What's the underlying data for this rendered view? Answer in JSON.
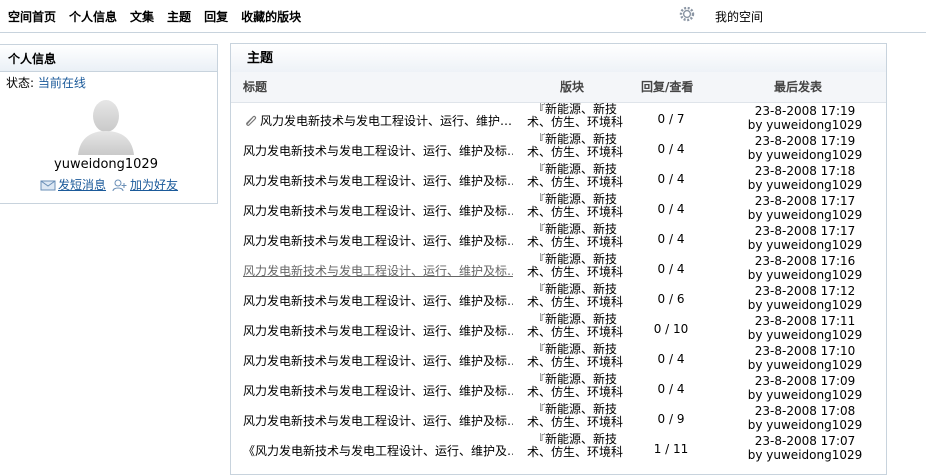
{
  "nav": {
    "links": [
      "空间首页",
      "个人信息",
      "文集",
      "主题",
      "回复",
      "收藏的版块"
    ],
    "my_space": "我的空间"
  },
  "profile": {
    "header": "个人信息",
    "status_label": "状态:",
    "status_value": "当前在线",
    "username": "yuweidong1029",
    "send_message": "发短消息",
    "add_friend": "加为好友"
  },
  "topics": {
    "header": "主题",
    "columns": {
      "title": "标题",
      "forum": "版块",
      "counts": "回复/查看",
      "last": "最后发表"
    },
    "rows": [
      {
        "title": "风力发电新技术与发电工程设计、运行、维护…",
        "forum": "『新能源、新技术、仿生、环境科",
        "counts": "0 / 7",
        "date": "23-8-2008 17:19",
        "by": "by yuweidong1029",
        "attachment": true
      },
      {
        "title": "风力发电新技术与发电工程设计、运行、维护及标…",
        "forum": "『新能源、新技术、仿生、环境科",
        "counts": "0 / 4",
        "date": "23-8-2008 17:19",
        "by": "by yuweidong1029"
      },
      {
        "title": "风力发电新技术与发电工程设计、运行、维护及标…",
        "forum": "『新能源、新技术、仿生、环境科",
        "counts": "0 / 4",
        "date": "23-8-2008 17:18",
        "by": "by yuweidong1029"
      },
      {
        "title": "风力发电新技术与发电工程设计、运行、维护及标…",
        "forum": "『新能源、新技术、仿生、环境科",
        "counts": "0 / 4",
        "date": "23-8-2008 17:17",
        "by": "by yuweidong1029"
      },
      {
        "title": "风力发电新技术与发电工程设计、运行、维护及标…",
        "forum": "『新能源、新技术、仿生、环境科",
        "counts": "0 / 4",
        "date": "23-8-2008 17:17",
        "by": "by yuweidong1029"
      },
      {
        "title": "风力发电新技术与发电工程设计、运行、维护及标…",
        "forum": "『新能源、新技术、仿生、环境科",
        "counts": "0 / 4",
        "date": "23-8-2008 17:16",
        "by": "by yuweidong1029",
        "link": true
      },
      {
        "title": "风力发电新技术与发电工程设计、运行、维护及标…",
        "forum": "『新能源、新技术、仿生、环境科",
        "counts": "0 / 6",
        "date": "23-8-2008 17:12",
        "by": "by yuweidong1029"
      },
      {
        "title": "风力发电新技术与发电工程设计、运行、维护及标…",
        "forum": "『新能源、新技术、仿生、环境科",
        "counts": "0 / 10",
        "date": "23-8-2008 17:11",
        "by": "by yuweidong1029"
      },
      {
        "title": "风力发电新技术与发电工程设计、运行、维护及标…",
        "forum": "『新能源、新技术、仿生、环境科",
        "counts": "0 / 4",
        "date": "23-8-2008 17:10",
        "by": "by yuweidong1029"
      },
      {
        "title": "风力发电新技术与发电工程设计、运行、维护及标…",
        "forum": "『新能源、新技术、仿生、环境科",
        "counts": "0 / 4",
        "date": "23-8-2008 17:09",
        "by": "by yuweidong1029"
      },
      {
        "title": "风力发电新技术与发电工程设计、运行、维护及标…",
        "forum": "『新能源、新技术、仿生、环境科",
        "counts": "0 / 9",
        "date": "23-8-2008 17:08",
        "by": "by yuweidong1029"
      },
      {
        "title": "《风力发电新技术与发电工程设计、运行、维护及…",
        "forum": "『新能源、新技术、仿生、环境科",
        "counts": "1 / 11",
        "date": "23-8-2008 17:07",
        "by": "by yuweidong1029"
      }
    ]
  }
}
